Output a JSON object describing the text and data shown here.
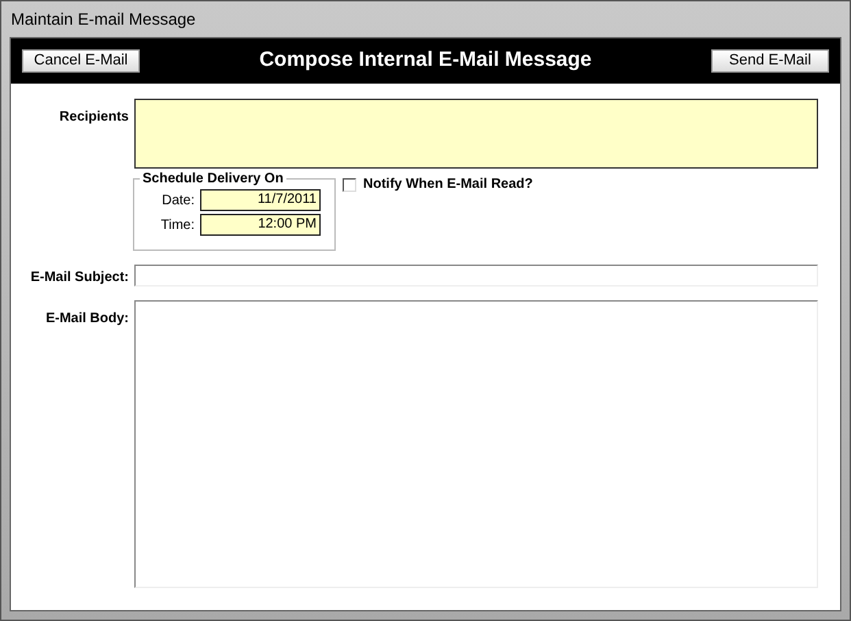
{
  "window": {
    "title": "Maintain E-mail Message"
  },
  "header": {
    "title": "Compose Internal E-Mail Message",
    "cancel_button": "Cancel E-Mail",
    "send_button": "Send E-Mail"
  },
  "recipients": {
    "label": "Recipients"
  },
  "schedule": {
    "legend": "Schedule Delivery On",
    "date_label": "Date:",
    "date_value": "11/7/2011",
    "time_label": "Time:",
    "time_value": "12:00 PM"
  },
  "notify": {
    "label": "Notify When E-Mail Read?",
    "checked": false
  },
  "subject": {
    "label": "E-Mail Subject:"
  },
  "body": {
    "label": "E-Mail Body:"
  }
}
